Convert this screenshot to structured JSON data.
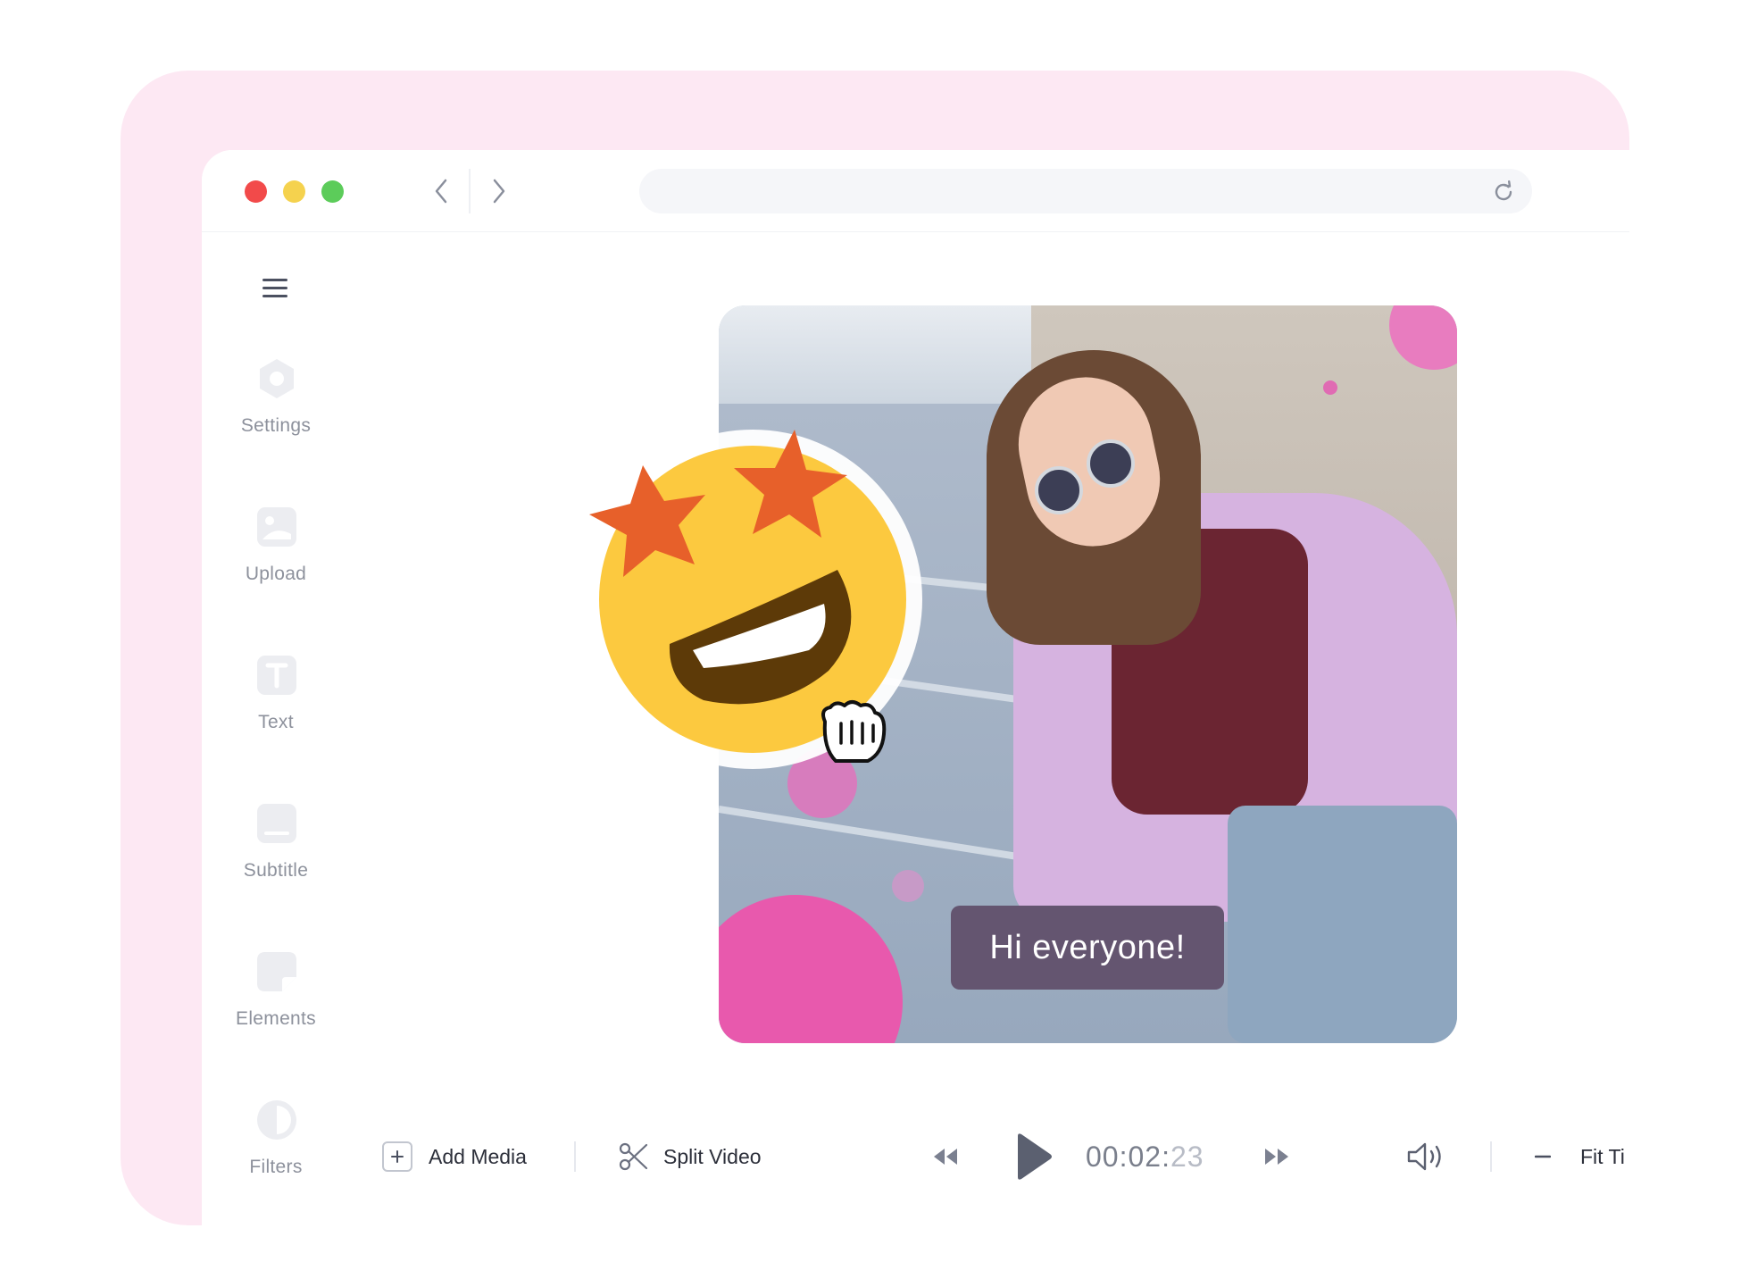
{
  "browser": {
    "traffic_lights": [
      "close",
      "minimize",
      "zoom"
    ],
    "address_value": ""
  },
  "sidebar": {
    "items": [
      {
        "label": "Settings",
        "icon": "gear-icon"
      },
      {
        "label": "Upload",
        "icon": "image-icon"
      },
      {
        "label": "Text",
        "icon": "text-icon"
      },
      {
        "label": "Subtitle",
        "icon": "subtitle-icon"
      },
      {
        "label": "Elements",
        "icon": "sticker-icon"
      },
      {
        "label": "Filters",
        "icon": "contrast-icon"
      }
    ]
  },
  "canvas": {
    "caption_text": "Hi everyone!"
  },
  "toolbar": {
    "add_media_label": "Add Media",
    "split_video_label": "Split Video",
    "time_main": "00:02:",
    "time_frames": "23",
    "fit_label": "Fit Ti"
  },
  "colors": {
    "accent_pink": "#e859ad",
    "caption_bg": "#645570",
    "frame_pink": "#fde8f3"
  }
}
